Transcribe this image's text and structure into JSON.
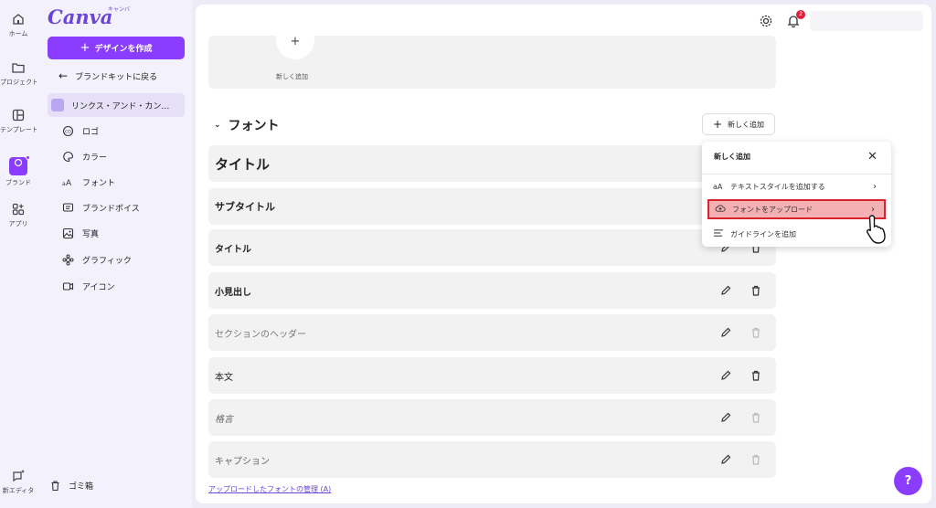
{
  "rail": {
    "items": [
      {
        "label": "ホーム",
        "icon": "home-icon"
      },
      {
        "label": "プロジェクト",
        "icon": "folder-icon"
      },
      {
        "label": "テンプレート",
        "icon": "template-icon"
      },
      {
        "label": "ブランド",
        "icon": "brand-icon"
      },
      {
        "label": "アプリ",
        "icon": "apps-icon"
      }
    ],
    "magic": {
      "label": "新エディタ",
      "icon": "chat-sparkle-icon"
    }
  },
  "side": {
    "logo": "Canva",
    "logo_sub": "キャンバ",
    "create_label": "デザインを作成",
    "back_label": "ブランドキットに戻る",
    "kit_name": "リンクス・アンド・カン…",
    "items": [
      {
        "label": "ロゴ",
        "icon": "logo-icon"
      },
      {
        "label": "カラー",
        "icon": "palette-icon"
      },
      {
        "label": "フォント",
        "icon": "font-icon"
      },
      {
        "label": "ブランドボイス",
        "icon": "voice-icon"
      },
      {
        "label": "写真",
        "icon": "photo-icon"
      },
      {
        "label": "グラフィック",
        "icon": "graphic-icon"
      },
      {
        "label": "アイコン",
        "icon": "icon-icon"
      }
    ],
    "trash_label": "ゴミ箱"
  },
  "header": {
    "notification_count": "2"
  },
  "main": {
    "add_new_card_label": "新しく追加",
    "section_title": "フォント",
    "add_new_button": "新しく追加",
    "rows": [
      {
        "label": "タイトル",
        "style": "title"
      },
      {
        "label": "サブタイトル",
        "style": "subtitle"
      },
      {
        "label": "タイトル",
        "style": "heading"
      },
      {
        "label": "小見出し",
        "style": "subheading"
      },
      {
        "label": "セクションのヘッダー",
        "style": "section"
      },
      {
        "label": "本文",
        "style": "body"
      },
      {
        "label": "格言",
        "style": "quote"
      },
      {
        "label": "キャプション",
        "style": "caption"
      }
    ],
    "footer_link": "アップロードしたフォントの管理 (A)"
  },
  "dropdown": {
    "title": "新しく追加",
    "items": [
      {
        "label": "テキストスタイルを追加する",
        "icon": "aa-text-icon"
      },
      {
        "label": "フォントをアップロード",
        "icon": "upload-cloud-icon"
      },
      {
        "label": "ガイドラインを追加",
        "icon": "guideline-icon"
      }
    ]
  },
  "help_label": "?",
  "colors": {
    "accent": "#8b3dff",
    "highlight_border": "#d9232d",
    "highlight_fill": "#f4b0b3"
  }
}
